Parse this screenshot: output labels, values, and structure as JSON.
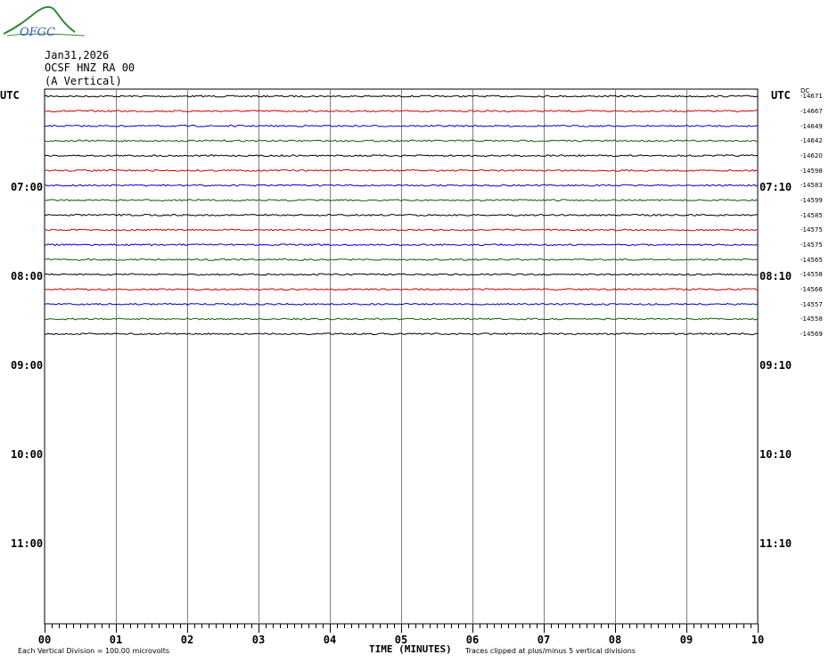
{
  "logo": {
    "text": "OFGC"
  },
  "header": {
    "date": "Jan31,2026",
    "station": "OCSF HNZ RA 00",
    "component": "(A Vertical)"
  },
  "utc_label": "UTC",
  "dc_label": "DC",
  "left_ticks": [
    "07:00",
    "08:00",
    "09:00",
    "10:00",
    "11:00"
  ],
  "right_ticks": [
    "07:10",
    "08:10",
    "09:10",
    "10:10",
    "11:10"
  ],
  "x_ticks": [
    "00",
    "01",
    "02",
    "03",
    "04",
    "05",
    "06",
    "07",
    "08",
    "09",
    "10"
  ],
  "xlabel": "TIME (MINUTES)",
  "footer": {
    "left": "Each Vertical Division =  100.00 microvolts",
    "right": "Traces clipped at plus/minus 5 vertical divisions"
  },
  "colors": {
    "black": "#000000",
    "red": "#cc0000",
    "blue": "#0000cc",
    "green": "#006600",
    "grid": "#808080"
  },
  "chart_data": {
    "type": "line",
    "x_range": [
      0,
      10
    ],
    "x_unit": "minutes",
    "rows_total": 36,
    "traces": [
      {
        "color": "black",
        "dc": -14671
      },
      {
        "color": "red",
        "dc": -14667
      },
      {
        "color": "blue",
        "dc": -14649
      },
      {
        "color": "green",
        "dc": -14642
      },
      {
        "color": "black",
        "dc": -14620
      },
      {
        "color": "red",
        "dc": -14598
      },
      {
        "color": "blue",
        "dc": -14583
      },
      {
        "color": "green",
        "dc": -14599
      },
      {
        "color": "black",
        "dc": -14585
      },
      {
        "color": "red",
        "dc": -14575
      },
      {
        "color": "blue",
        "dc": -14575
      },
      {
        "color": "green",
        "dc": -14565
      },
      {
        "color": "black",
        "dc": -14558
      },
      {
        "color": "red",
        "dc": -14566
      },
      {
        "color": "blue",
        "dc": -14557
      },
      {
        "color": "green",
        "dc": -14558
      },
      {
        "color": "black",
        "dc": -14569
      }
    ]
  }
}
